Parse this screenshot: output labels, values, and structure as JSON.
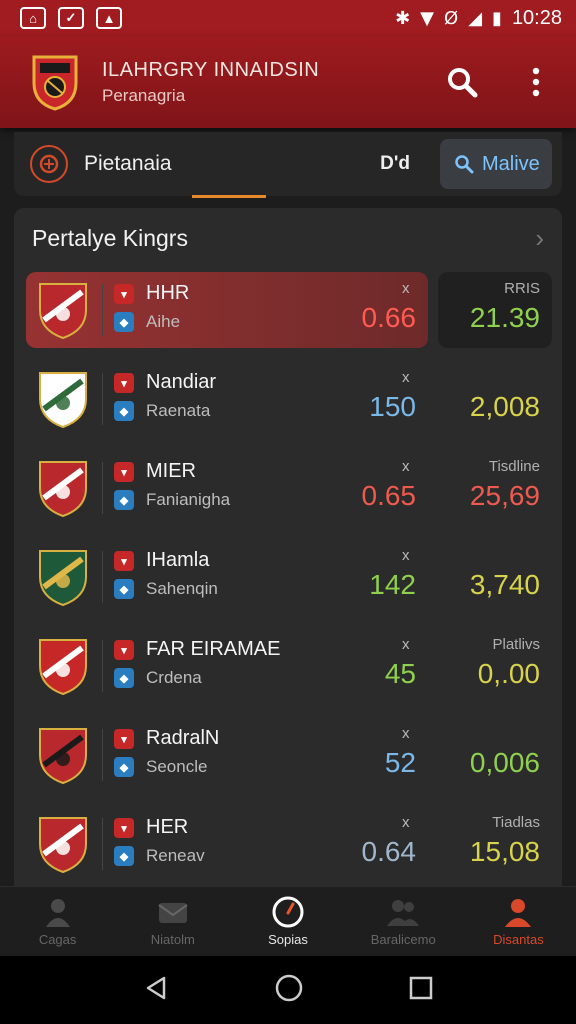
{
  "status_bar": {
    "left_icons": [
      "home-icon",
      "check-icon",
      "photo-icon"
    ],
    "right_icons": [
      "bluetooth-icon",
      "wifi-icon",
      "nfc-icon",
      "signal-icon",
      "battery-icon"
    ],
    "time": "10:28"
  },
  "app_bar": {
    "title": "ILAHRGRY INNAIDSIN",
    "subtitle": "Peranagria"
  },
  "tab_bar": {
    "active_tab": "Pietanaia",
    "dropdown": "D'd",
    "search_label": "Malive"
  },
  "list": {
    "title": "Pertalye Kingrs",
    "rows": [
      {
        "name": "HHR",
        "sub": "Aihe",
        "mark": "x",
        "value": "0.66",
        "value_color": "#ff5b52",
        "stat_label": "RRIS",
        "stat_value": "21.39",
        "stat_color": "#8fd14f",
        "highlighted": true
      },
      {
        "name": "Nandiar",
        "sub": "Raenata",
        "mark": "x",
        "value": "150",
        "value_color": "#7ab8e8",
        "stat_label": "",
        "stat_value": "2,008",
        "stat_color": "#d7d34a"
      },
      {
        "name": "MIER",
        "sub": "Fanianigha",
        "mark": "x",
        "value": "0.65",
        "value_color": "#ef5a4e",
        "stat_label": "Tisdline",
        "stat_value": "25,69",
        "stat_color": "#ef5a4e"
      },
      {
        "name": "IHamla",
        "sub": "Sahenqin",
        "mark": "x",
        "value": "142",
        "value_color": "#8fd14f",
        "stat_label": "",
        "stat_value": "3,740",
        "stat_color": "#d7d34a"
      },
      {
        "name": "FAR EIRAMAE",
        "sub": "Crdena",
        "mark": "x",
        "value": "45",
        "value_color": "#8fd14f",
        "stat_label": "Platlivs",
        "stat_value": "0,.00",
        "stat_color": "#d7d34a"
      },
      {
        "name": "RadralN",
        "sub": "Seoncle",
        "mark": "x",
        "value": "52",
        "value_color": "#7ab8e8",
        "stat_label": "",
        "stat_value": "0,006",
        "stat_color": "#8fd14f"
      },
      {
        "name": "HER",
        "sub": "Reneav",
        "mark": "x",
        "value": "0.64",
        "value_color": "#9fb6cc",
        "stat_label": "Tiadlas",
        "stat_value": "15,08",
        "stat_color": "#d7d34a"
      }
    ]
  },
  "bottom_nav": [
    {
      "label": "Cagas",
      "icon": "person-icon"
    },
    {
      "label": "Niatolm",
      "icon": "mail-icon"
    },
    {
      "label": "Sopias",
      "icon": "gauge-icon"
    },
    {
      "label": "Baralicemo",
      "icon": "group-icon"
    },
    {
      "label": "Disantas",
      "icon": "user-alert-icon"
    }
  ],
  "colors": {
    "brand_red": "#a01c20",
    "accent_orange": "#e58a2b",
    "background": "#1d1d1d"
  }
}
